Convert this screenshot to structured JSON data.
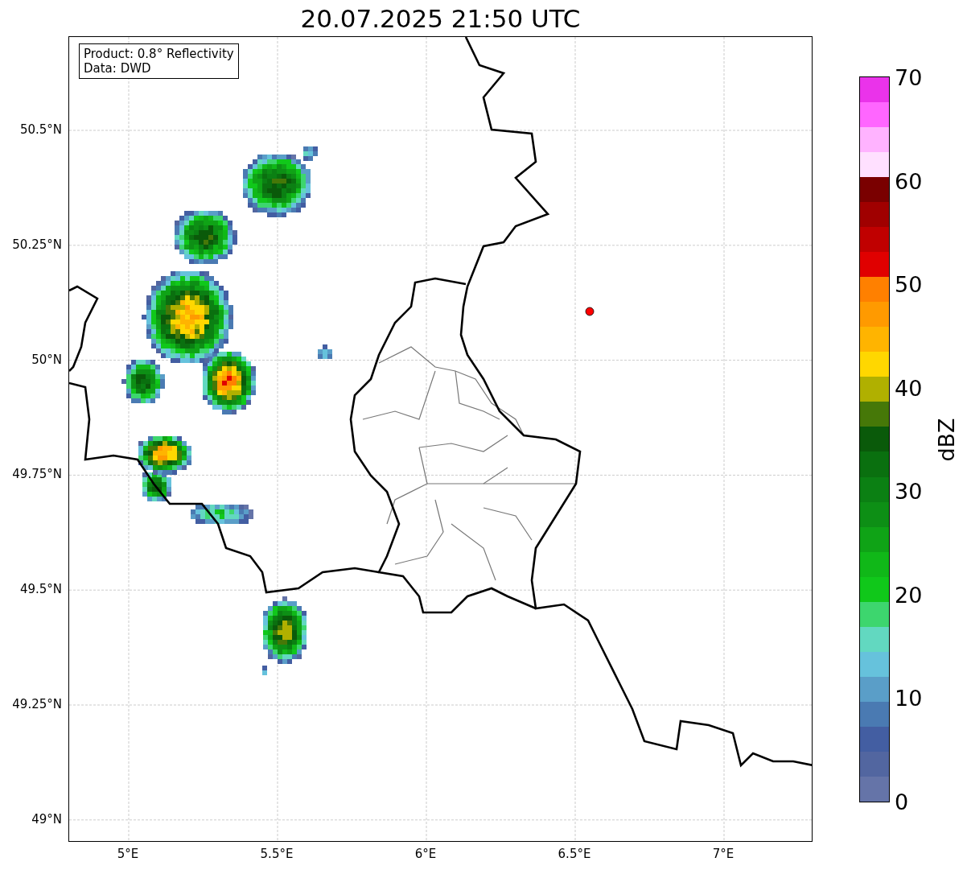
{
  "title": "20.07.2025 21:50 UTC",
  "info_box": {
    "lines": [
      "Product: 0.8° Reflectivity",
      "Data: DWD"
    ]
  },
  "map": {
    "yticks": [
      "50.5°N",
      "50.25°N",
      "50°N",
      "49.75°N",
      "49.5°N",
      "49.25°N",
      "49°N"
    ],
    "xticks": [
      "5°E",
      "5.5°E",
      "6°E",
      "6.5°E",
      "7°E"
    ]
  },
  "colorbar": {
    "label": "dBZ",
    "ticks": [
      "70",
      "60",
      "50",
      "40",
      "30",
      "20",
      "10",
      "0"
    ],
    "levels": [
      {
        "color": "#ea33ea"
      },
      {
        "color": "#ff66ff"
      },
      {
        "color": "#ffb3ff"
      },
      {
        "color": "#ffe0ff"
      },
      {
        "color": "#7a0000"
      },
      {
        "color": "#a00000"
      },
      {
        "color": "#c00000"
      },
      {
        "color": "#e00000"
      },
      {
        "color": "#ff8000"
      },
      {
        "color": "#ff9a00"
      },
      {
        "color": "#ffb400"
      },
      {
        "color": "#ffd700"
      },
      {
        "color": "#b0b000"
      },
      {
        "color": "#467808"
      },
      {
        "color": "#0a5a0a"
      },
      {
        "color": "#0a700f"
      },
      {
        "color": "#0b8013"
      },
      {
        "color": "#0d8f15"
      },
      {
        "color": "#0fa316"
      },
      {
        "color": "#10b818"
      },
      {
        "color": "#10c81a"
      },
      {
        "color": "#3dd66e"
      },
      {
        "color": "#62d8c0"
      },
      {
        "color": "#66c2dc"
      },
      {
        "color": "#5a9ec8"
      },
      {
        "color": "#4a7ab2"
      },
      {
        "color": "#435ea2"
      },
      {
        "color": "#5266a0"
      },
      {
        "color": "#6574a8"
      }
    ]
  }
}
